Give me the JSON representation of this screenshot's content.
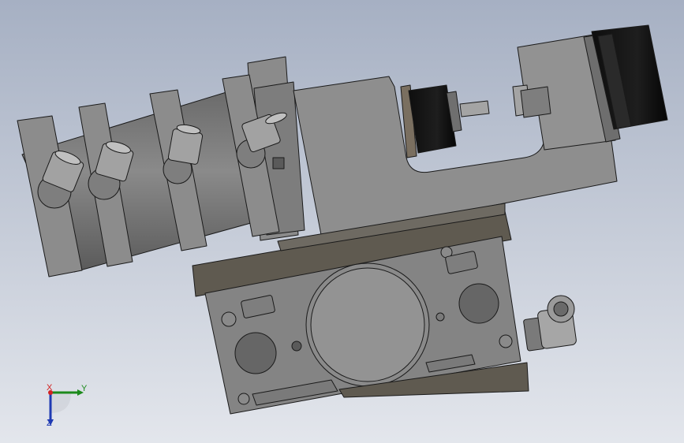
{
  "viewport": {
    "background_top": "#a6b0c3",
    "background_bottom": "#e3e6ec",
    "part_fill": "#878787",
    "part_dark": "#5f5a50",
    "outline": "#1a1a1a"
  },
  "triad": {
    "x_label": "X",
    "y_label": "Y",
    "z_label": "Z",
    "x_color": "#d22222",
    "y_color": "#1c8a1c",
    "z_color": "#1f3ab3"
  }
}
